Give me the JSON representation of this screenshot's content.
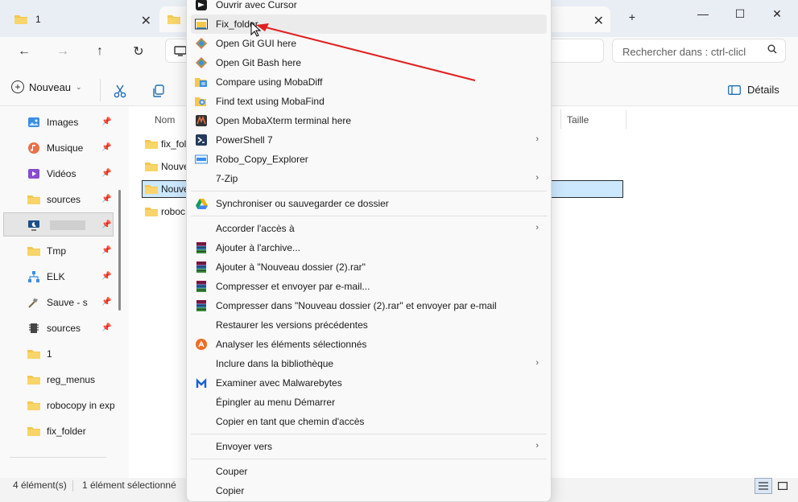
{
  "tabs": [
    {
      "title": "1",
      "active": false
    },
    {
      "title": "",
      "active": true
    }
  ],
  "window_controls": {
    "new_tab": "+",
    "minimize": "—",
    "maximize": "☐",
    "close": "✕"
  },
  "search": {
    "placeholder": "Rechercher dans : ctrl-clicl"
  },
  "toolbar": {
    "new_label": "Nouveau",
    "details_label": "Détails"
  },
  "sidebar": {
    "items": [
      {
        "label": "Images",
        "icon": "images-icon",
        "pinned": true
      },
      {
        "label": "Musique",
        "icon": "music-icon",
        "pinned": true
      },
      {
        "label": "Vidéos",
        "icon": "videos-icon",
        "pinned": true
      },
      {
        "label": "sources",
        "icon": "folder-icon",
        "pinned": true
      },
      {
        "label": "",
        "icon": "computer-icon",
        "pinned": true
      },
      {
        "label": "Tmp",
        "icon": "folder-icon",
        "pinned": true
      },
      {
        "label": "ELK",
        "icon": "network-icon",
        "pinned": true
      },
      {
        "label": "Sauve - s",
        "icon": "tools-icon",
        "pinned": true
      },
      {
        "label": "sources",
        "icon": "chip-icon",
        "pinned": true
      },
      {
        "label": "1",
        "icon": "folder-icon",
        "pinned": false
      },
      {
        "label": "reg_menus",
        "icon": "folder-icon",
        "pinned": false
      },
      {
        "label": "robocopy in exp",
        "icon": "folder-icon",
        "pinned": false
      },
      {
        "label": "fix_folder",
        "icon": "folder-icon",
        "pinned": false
      }
    ]
  },
  "files": {
    "columns": {
      "name": "Nom",
      "size": "Taille"
    },
    "rows": [
      {
        "name": "fix_fol"
      },
      {
        "name": "Nouve"
      },
      {
        "name": "Nouve"
      },
      {
        "name": "roboc"
      }
    ]
  },
  "status": {
    "count": "4 élément(s)",
    "selected": "1 élément sélectionné"
  },
  "context_menu": {
    "items": [
      {
        "label": "Ouvrir avec Cursor",
        "icon": "cursor-app-icon"
      },
      {
        "label": "Fix_folder",
        "icon": "fix-folder-icon"
      },
      {
        "label": "Open Git GUI here",
        "icon": "git-icon"
      },
      {
        "label": "Open Git Bash here",
        "icon": "git-icon"
      },
      {
        "label": "Compare using MobaDiff",
        "icon": "mobadiff-icon"
      },
      {
        "label": "Find text using MobaFind",
        "icon": "mobafind-icon"
      },
      {
        "label": "Open MobaXterm terminal here",
        "icon": "mobaxterm-icon"
      },
      {
        "label": "PowerShell 7",
        "icon": "powershell-icon"
      },
      {
        "label": "Robo_Copy_Explorer",
        "icon": "robocopy-icon"
      },
      {
        "label": "7-Zip",
        "icon": ""
      },
      {
        "label": "Synchroniser ou sauvegarder ce dossier",
        "icon": "google-drive-icon"
      },
      {
        "label": "Accorder l'accès à",
        "icon": ""
      },
      {
        "label": "Ajouter à l'archive...",
        "icon": "winrar-icon"
      },
      {
        "label": "Ajouter à \"Nouveau dossier (2).rar\"",
        "icon": "winrar-icon"
      },
      {
        "label": "Compresser et envoyer par e-mail...",
        "icon": "winrar-icon"
      },
      {
        "label": "Compresser dans \"Nouveau dossier (2).rar\" et envoyer par e-mail",
        "icon": "winrar-icon"
      },
      {
        "label": "Restaurer les versions précédentes",
        "icon": ""
      },
      {
        "label": "Analyser les éléments sélectionnés",
        "icon": "avast-icon"
      },
      {
        "label": "Inclure dans la bibliothèque",
        "icon": ""
      },
      {
        "label": "Examiner avec Malwarebytes",
        "icon": "malwarebytes-icon"
      },
      {
        "label": "Épingler au menu Démarrer",
        "icon": ""
      },
      {
        "label": "Copier en tant que chemin d'accès",
        "icon": ""
      },
      {
        "label": "Envoyer vers",
        "icon": ""
      },
      {
        "label": "Couper",
        "icon": ""
      },
      {
        "label": "Copier",
        "icon": ""
      }
    ]
  },
  "colors": {
    "folder": "#f4c74f",
    "selection": "#cce8ff",
    "annotation_arrow": "#e02020",
    "menu_bg": "#f9f9f9"
  }
}
